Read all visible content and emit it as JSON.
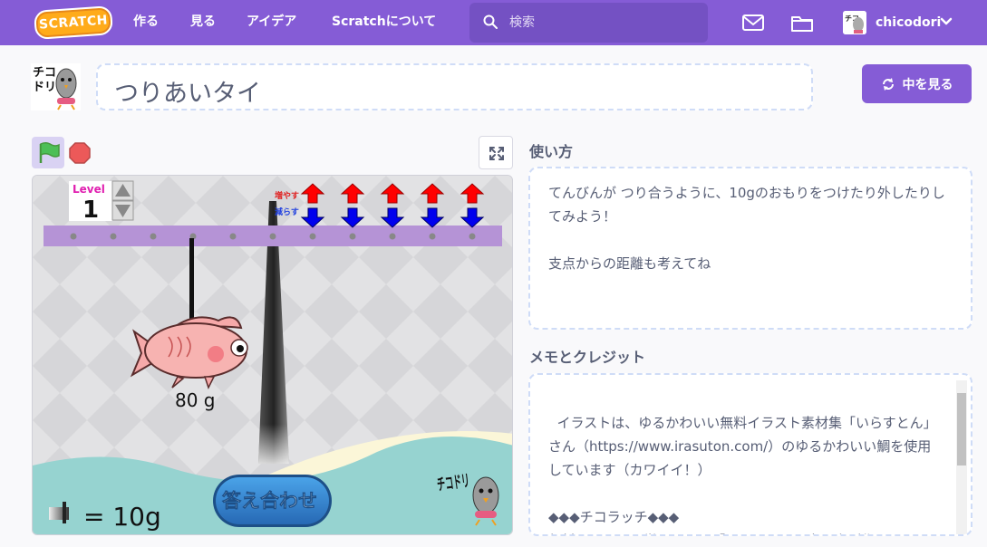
{
  "nav": {
    "logo": "SCRATCH",
    "links": [
      "作る",
      "見る",
      "アイデア",
      "Scratchについて"
    ],
    "search_placeholder": "検索",
    "username": "chicodori"
  },
  "project": {
    "title": "つりあいタイ",
    "see_inside": "中を見る"
  },
  "stage": {
    "level_label": "Level",
    "level_value": "1",
    "increase_label": "増やす",
    "decrease_label": "減らす",
    "fish_weight": "80 g",
    "answer_button": "答え合わせ",
    "weight_legend": "= 10g",
    "logo_text": "チコドリ"
  },
  "instructions": {
    "title": "使い方",
    "text": "てんびんが つり合うように、10gのおもりをつけたり外したりしてみよう！\n\n支点からの距離も考えてね"
  },
  "notes": {
    "title": "メモとクレジット",
    "text": "イラストは、ゆるかわいい無料イラスト素材集「いらすとん」さん（https://www.irasuton.com/）のゆるかわいい鯛を使用しています（カワイイ！）\n\n◆◆◆チコラッチ◆◆◆\n無料オンライン学習ドリル「チコドリ」の中の人が作"
  },
  "colors": {
    "nav": "#855cd6",
    "beam": "#b593d6",
    "water": "#96d3d0",
    "answer": "#3380c9"
  }
}
